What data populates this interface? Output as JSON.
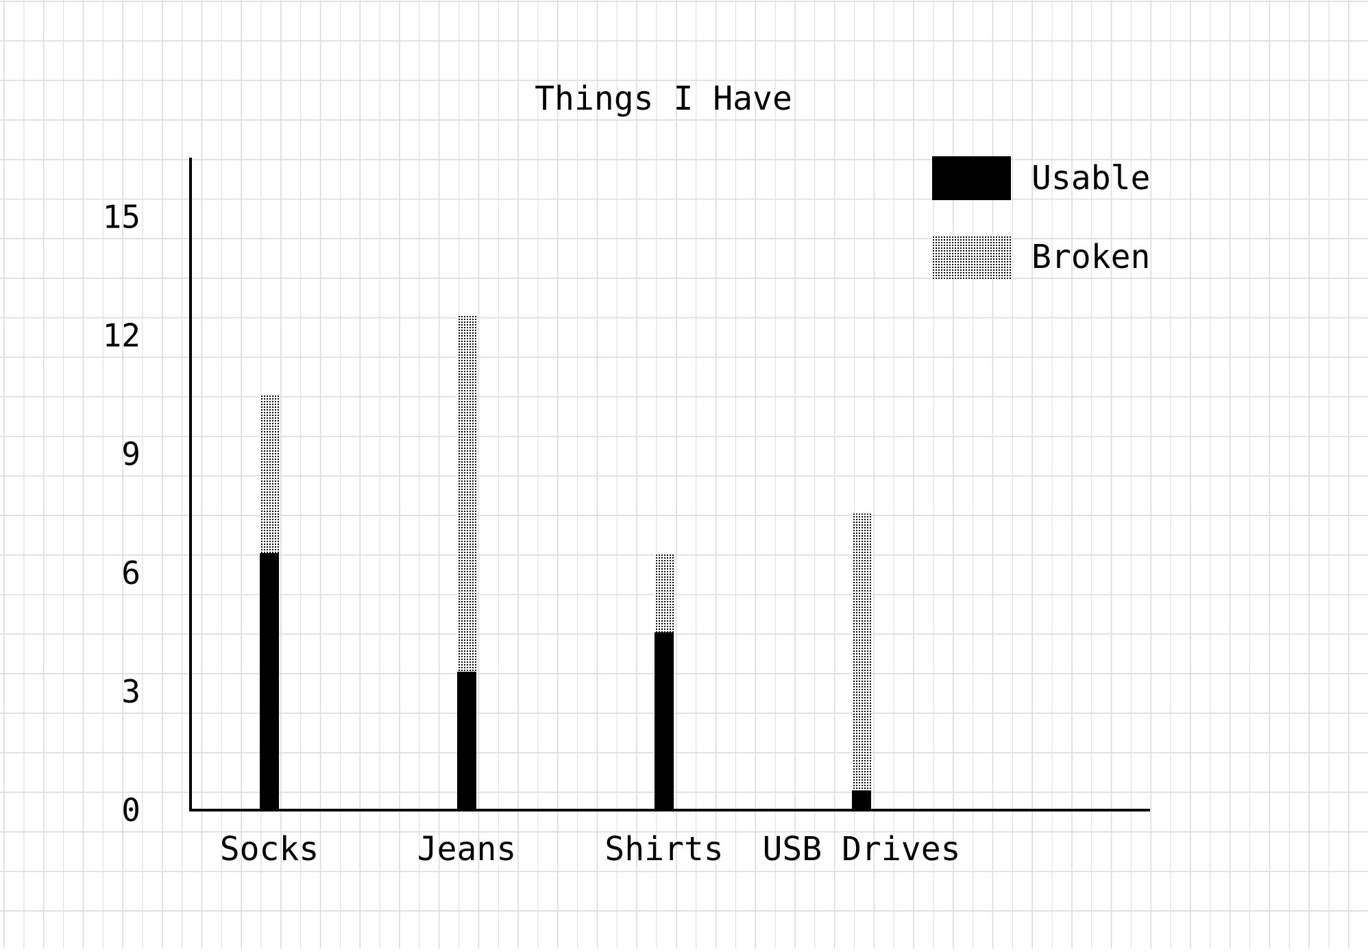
{
  "chart_data": {
    "type": "bar",
    "stacked": true,
    "title": "Things I Have",
    "xlabel": "",
    "ylabel": "",
    "categories": [
      "Socks",
      "Jeans",
      "Shirts",
      "USB Drives"
    ],
    "series": [
      {
        "name": "Usable",
        "values": [
          6.5,
          3.5,
          4.5,
          0.5
        ],
        "pattern": "solid"
      },
      {
        "name": "Broken",
        "values": [
          4,
          9,
          2,
          7
        ],
        "pattern": "dots"
      }
    ],
    "yticks": [
      0,
      3,
      6,
      9,
      12,
      15
    ],
    "ylim": [
      0,
      16.5
    ],
    "grid": true,
    "legend_position": "top-right",
    "colors": {
      "background": "#ffffff",
      "grid": "#dcdcdc",
      "ink": "#000000"
    }
  }
}
